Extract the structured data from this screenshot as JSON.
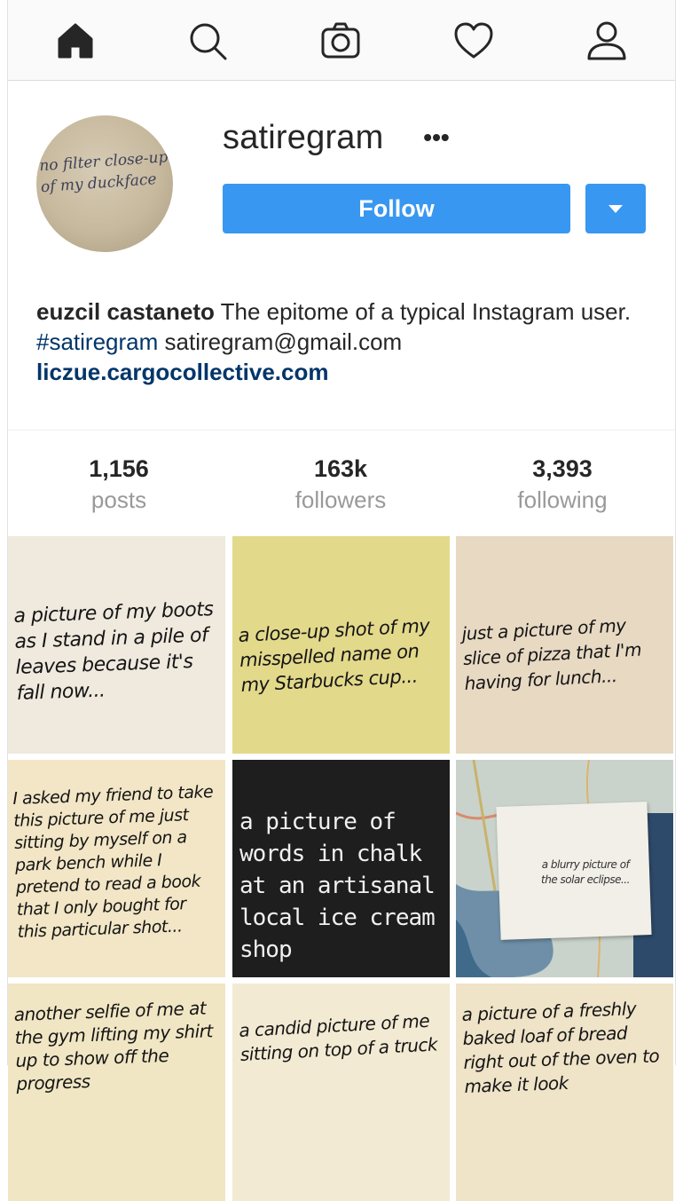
{
  "nav": {
    "icons": [
      "home-icon",
      "search-icon",
      "camera-icon",
      "heart-icon",
      "profile-icon"
    ]
  },
  "profile": {
    "avatar_caption": "no filter close-up of my duckface",
    "username": "satiregram",
    "more_label": "•••",
    "follow_label": "Follow",
    "accent_color": "#3897f0"
  },
  "bio": {
    "name": "euzcil castaneto",
    "text": " The epitome of a typical Instagram user. ",
    "hashtag": "#satiregram",
    "email": " satiregram@gmail.com",
    "link": "liczue.cargocollective.com"
  },
  "stats": [
    {
      "value": "1,156",
      "label": "posts"
    },
    {
      "value": "163k",
      "label": "followers"
    },
    {
      "value": "3,393",
      "label": "following"
    }
  ],
  "posts": [
    {
      "caption": "a picture of my boots as I stand in a pile of leaves because it's fall now...",
      "bg": "#efe9de"
    },
    {
      "caption": "a close-up shot of my misspelled name on my Starbucks cup...",
      "bg": "#e3d98b"
    },
    {
      "caption": "just a picture of my slice of pizza that I'm having for lunch...",
      "bg": "#e8d9c3"
    },
    {
      "caption": "I asked my friend to take this picture of me just sitting by myself on a park bench while I pretend to read a book that I only bought for this particular shot...",
      "bg": "#f2e6c6"
    },
    {
      "caption": "a picture of words in chalk at an artisanal local ice cream shop",
      "bg": "#1e1e1e"
    },
    {
      "caption": "a blurry picture of the solar eclipse...",
      "bg": "#8aa4b0"
    },
    {
      "caption": "another selfie of me at the gym lifting my shirt up to show off the progress",
      "bg": "#f1e6c4"
    },
    {
      "caption": "a candid picture of me sitting on top of a truck",
      "bg": "#f3ead3"
    },
    {
      "caption": "a picture of a freshly baked loaf of bread right out of the oven to make it look",
      "bg": "#efe3c8"
    }
  ]
}
